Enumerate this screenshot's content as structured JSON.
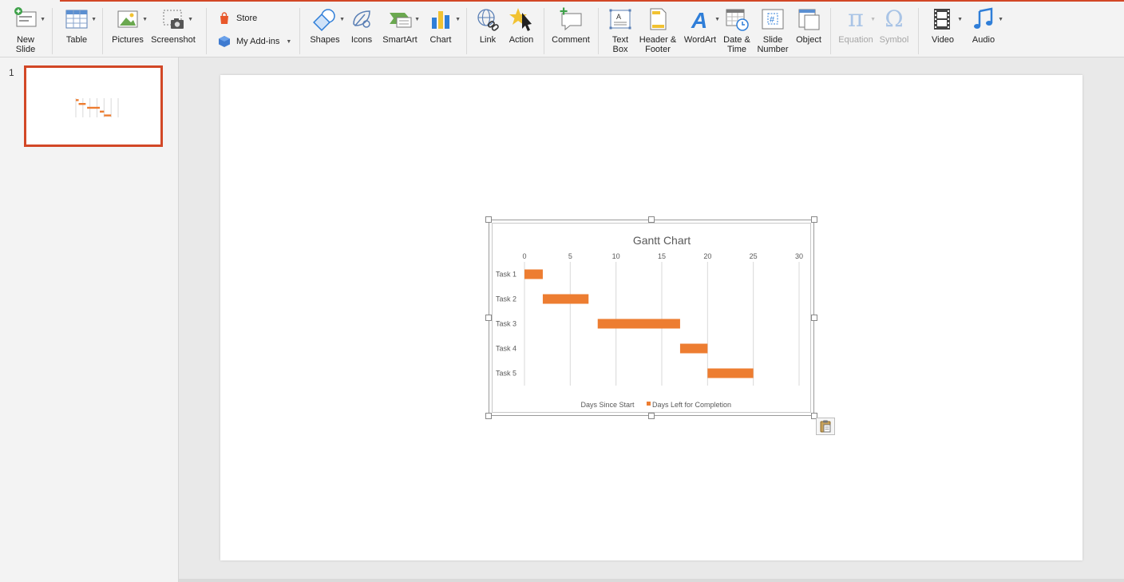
{
  "ribbon": {
    "new_slide": "New\nSlide",
    "table": "Table",
    "pictures": "Pictures",
    "screenshot": "Screenshot",
    "store": "Store",
    "my_addins": "My Add-ins",
    "shapes": "Shapes",
    "icons": "Icons",
    "smartart": "SmartArt",
    "chart": "Chart",
    "link": "Link",
    "action": "Action",
    "comment": "Comment",
    "textbox": "Text\nBox",
    "header_footer": "Header &\nFooter",
    "wordart": "WordArt",
    "date_time": "Date &\nTime",
    "slide_number": "Slide\nNumber",
    "object": "Object",
    "equation": "Equation",
    "symbol": "Symbol",
    "video": "Video",
    "audio": "Audio"
  },
  "thumbnails": [
    {
      "number": "1"
    }
  ],
  "colors": {
    "accent": "#d24726",
    "bar": "#ed7d31",
    "icon_blue": "#2f7ed8"
  },
  "chart_data": {
    "type": "bar",
    "orientation": "horizontal",
    "stacked": true,
    "title": "Gantt Chart",
    "categories": [
      "Task 1",
      "Task 2",
      "Task 3",
      "Task 4",
      "Task 5"
    ],
    "series": [
      {
        "name": "Days Since Start",
        "values": [
          0,
          2,
          8,
          17,
          20
        ],
        "color": "none"
      },
      {
        "name": "Days Left for Completion",
        "values": [
          2,
          5,
          9,
          3,
          5
        ],
        "color": "#ed7d31"
      }
    ],
    "xlim": [
      0,
      30
    ],
    "xticks": [
      "0",
      "5",
      "10",
      "15",
      "20",
      "25",
      "30"
    ],
    "axis_position": "top",
    "grid": true,
    "legend": "bottom"
  }
}
